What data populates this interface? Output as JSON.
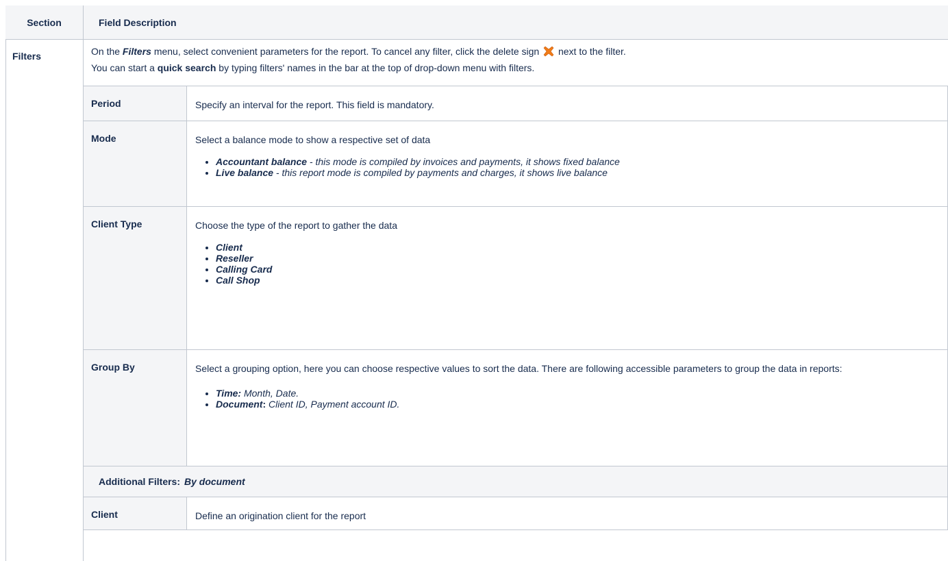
{
  "header": {
    "section": "Section",
    "field_description": "Field Description"
  },
  "filters": {
    "label": "Filters",
    "intro_on_the": "On the ",
    "intro_menu_name": "Filters",
    "intro_rest": " menu, select convenient parameters for the report. To cancel any filter, click the delete sign ",
    "intro_end": " next to the filter.",
    "quick_prefix": "You can start a ",
    "quick_bold": "quick search",
    "quick_rest": " by typing filters' names in the bar at the top of drop-down menu with filters.",
    "delete_icon_color": "#f07c19"
  },
  "rows": {
    "period": {
      "label": "Period",
      "desc": "Specify an interval for the report. This field is mandatory."
    },
    "mode": {
      "label": "Mode",
      "desc": "Select a balance mode to show a respective set of data",
      "items": [
        {
          "name": "Accountant balance",
          "text": " - this mode is compiled by invoices and payments, it shows fixed balance"
        },
        {
          "name": "Live balance",
          "text": " - this report mode is compiled by payments and charges, it shows live balance"
        }
      ]
    },
    "client_type": {
      "label": "Client Type",
      "desc": "Choose the type of the report to gather the data",
      "items": [
        "Client",
        "Reseller",
        "Calling Card",
        "Call Shop"
      ]
    },
    "group_by": {
      "label": "Group By",
      "desc": "Select a grouping option, here you can choose respective values to sort the data. There are following accessible parameters to group the data in reports:",
      "items": [
        {
          "name": "Time:",
          "text": " Month, Date."
        },
        {
          "name": "Document",
          "colon": ":",
          "text": " Client ID, Payment account ID."
        }
      ]
    },
    "additional": {
      "label": "Additional Filters:",
      "value": "By document"
    },
    "client": {
      "label": "Client",
      "desc": "Define an origination client for the report"
    }
  }
}
